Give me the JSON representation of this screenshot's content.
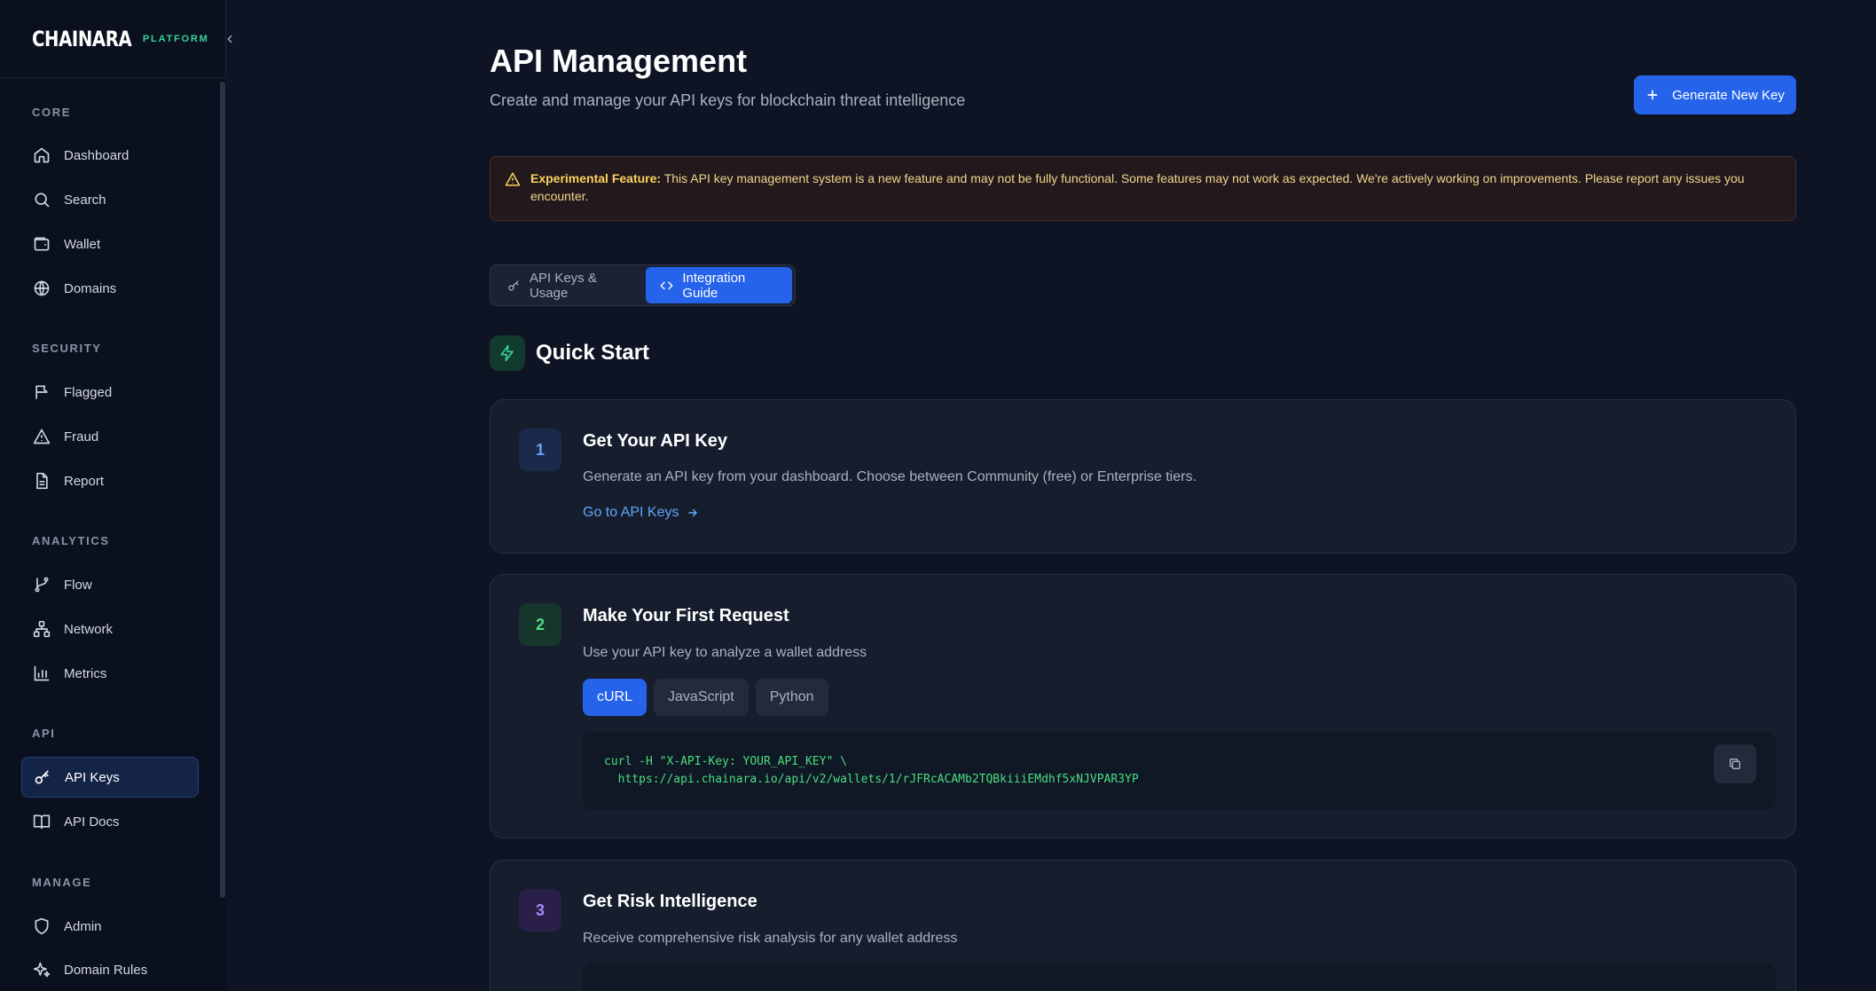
{
  "brand": {
    "name": "CHAINARA",
    "tag": "PLATFORM"
  },
  "nav": {
    "sections": [
      {
        "title": "CORE",
        "items": [
          {
            "label": "Dashboard",
            "icon": "home-icon"
          },
          {
            "label": "Search",
            "icon": "search-icon"
          },
          {
            "label": "Wallet",
            "icon": "wallet-icon"
          },
          {
            "label": "Domains",
            "icon": "globe-icon"
          }
        ]
      },
      {
        "title": "SECURITY",
        "items": [
          {
            "label": "Flagged",
            "icon": "flag-icon"
          },
          {
            "label": "Fraud",
            "icon": "warning-icon"
          },
          {
            "label": "Report",
            "icon": "document-icon"
          }
        ]
      },
      {
        "title": "ANALYTICS",
        "items": [
          {
            "label": "Flow",
            "icon": "git-branch-icon"
          },
          {
            "label": "Network",
            "icon": "network-icon"
          },
          {
            "label": "Metrics",
            "icon": "bar-chart-icon"
          }
        ]
      },
      {
        "title": "API",
        "items": [
          {
            "label": "API Keys",
            "icon": "key-icon",
            "active": true
          },
          {
            "label": "API Docs",
            "icon": "book-icon"
          }
        ]
      },
      {
        "title": "MANAGE",
        "items": [
          {
            "label": "Admin",
            "icon": "shield-icon"
          },
          {
            "label": "Domain Rules",
            "icon": "sparkles-icon"
          }
        ]
      }
    ]
  },
  "header": {
    "title": "API Management",
    "subtitle": "Create and manage your API keys for blockchain threat intelligence",
    "generate_label": "Generate New Key"
  },
  "alert": {
    "label": "Experimental Feature:",
    "text": " This API key management system is a new feature and may not be fully functional. Some features may not work as expected. We're actively working on improvements. Please report any issues you encounter."
  },
  "tabs": [
    {
      "label": "API Keys & Usage"
    },
    {
      "label": "Integration Guide",
      "active": true
    }
  ],
  "quick_start": {
    "title": "Quick Start",
    "steps": [
      {
        "number": "1",
        "title": "Get Your API Key",
        "desc": "Generate an API key from your dashboard. Choose between Community (free) or Enterprise tiers.",
        "link": "Go to API Keys"
      },
      {
        "number": "2",
        "title": "Make Your First Request",
        "desc": "Use your API key to analyze a wallet address",
        "langs": [
          "cURL",
          "JavaScript",
          "Python"
        ],
        "active_lang": "cURL",
        "code_line1": "curl -H \"X-API-Key: YOUR_API_KEY\" \\",
        "code_line2": "  https://api.chainara.io/api/v2/wallets/1/rJFRcACAMb2TQBkiiiEMdhf5xNJVPAR3YP"
      },
      {
        "number": "3",
        "title": "Get Risk Intelligence",
        "desc": "Receive comprehensive risk analysis for any wallet address"
      }
    ]
  },
  "colors": {
    "accent": "#2563eb",
    "success": "#34d399",
    "warning": "#fbd25b",
    "purple": "#a78bfa"
  }
}
